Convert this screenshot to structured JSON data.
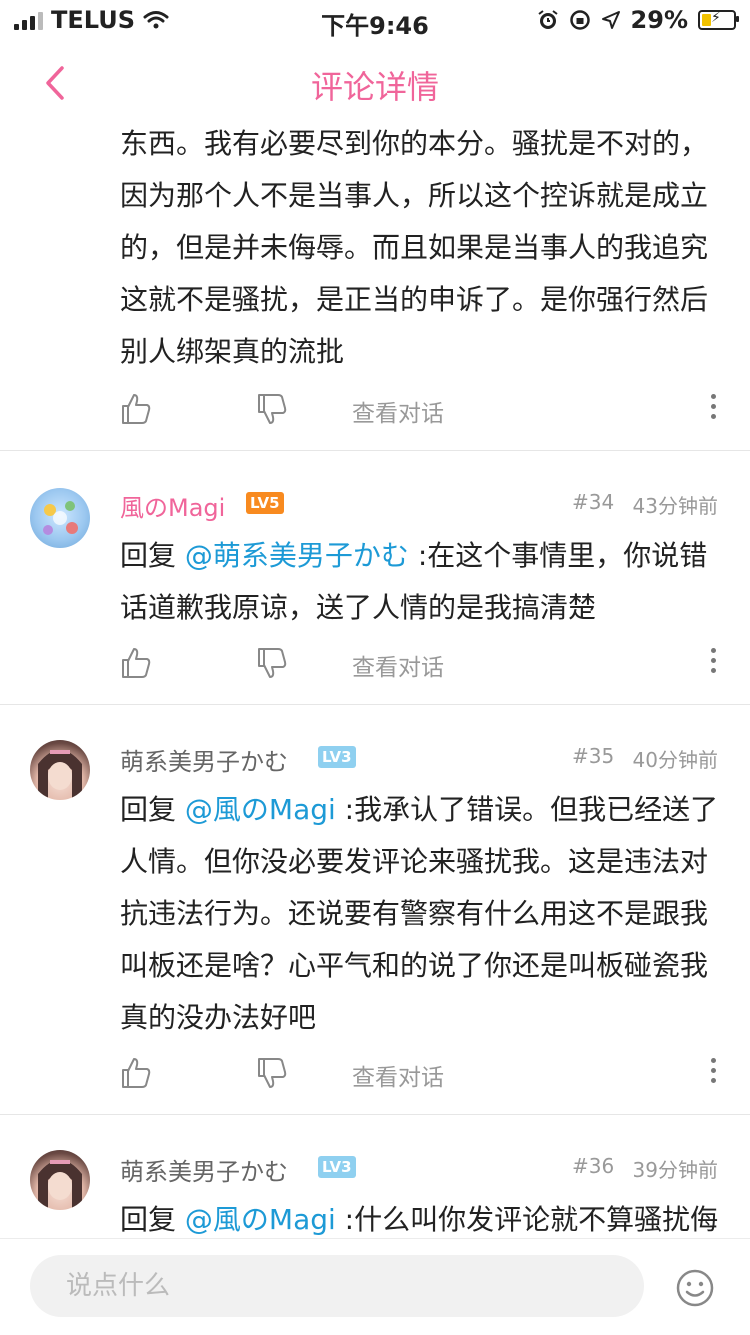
{
  "status_bar": {
    "carrier": "TELUS",
    "time": "下午9:46",
    "battery": "29%"
  },
  "nav": {
    "title": "评论详情"
  },
  "comments": [
    {
      "text": "东西。我有必要尽到你的本分。骚扰是不对的，因为那个人不是当事人，所以这个控诉就是成立的，但是并未侮辱。而且如果是当事人的我追究这就不是骚扰，是正当的申诉了。是你强行然后别人绑架真的流批",
      "view_label": "查看对话"
    },
    {
      "username": "風のMagi",
      "level": "LV5",
      "floor": "#34",
      "time": "43分钟前",
      "reply_prefix": "回复 ",
      "mention": "@萌系美男子かむ",
      "text": " :在这个事情里，你说错话道歉我原谅，送了人情的是我搞清楚",
      "view_label": "查看对话"
    },
    {
      "username": "萌系美男子かむ",
      "level": "LV3",
      "floor": "#35",
      "time": "40分钟前",
      "reply_prefix": "回复 ",
      "mention": "@風のMagi",
      "text": " :我承认了错误。但我已经送了人情。但你没必要发评论来骚扰我。这是违法对抗违法行为。还说要有警察有什么用这不是跟我叫板还是啥？心平气和的说了你还是叫板碰瓷我真的没办法好吧",
      "view_label": "查看对话"
    },
    {
      "username": "萌系美男子かむ",
      "level": "LV3",
      "floor": "#36",
      "time": "39分钟前",
      "reply_prefix": "回复 ",
      "mention": "@風のMagi",
      "text": " :什么叫你发评论就不算骚扰侮"
    }
  ],
  "bottom": {
    "input_placeholder": "说点什么"
  },
  "colors": {
    "accent": "#f0659a",
    "mention": "#1d9ad6",
    "lv5": "#f88a1f",
    "lv3": "#8fd0f0"
  },
  "icons": [
    "back-chevron-icon",
    "thumbs-up-icon",
    "thumbs-down-icon",
    "more-vertical-icon",
    "emoji-icon"
  ]
}
